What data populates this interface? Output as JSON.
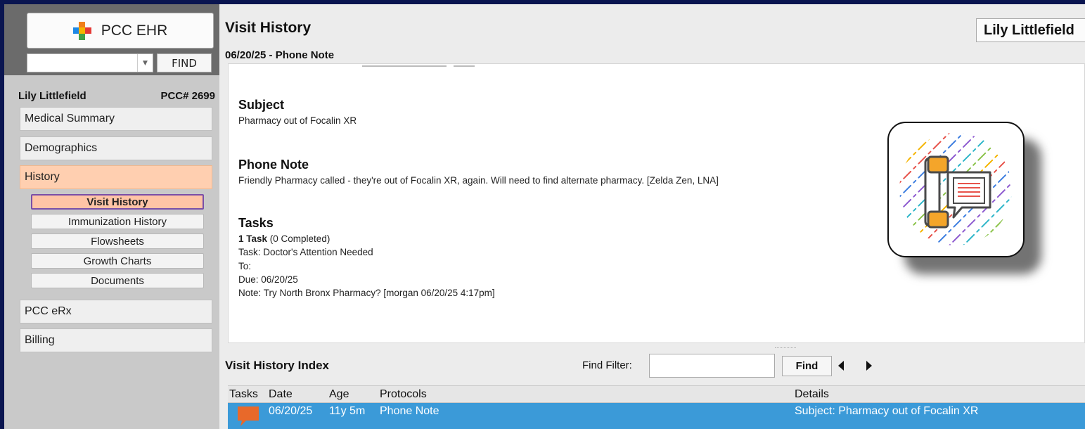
{
  "app": {
    "brand_title": "PCC EHR",
    "find_label": "FIND",
    "search_value": ""
  },
  "patient": {
    "name": "Lily Littlefield",
    "pcc_number": "PCC# 2699"
  },
  "nav": {
    "items": [
      {
        "label": "Medical Summary",
        "active": false
      },
      {
        "label": "Demographics",
        "active": false
      },
      {
        "label": "History",
        "active": true
      },
      {
        "label": "PCC eRx",
        "active": false
      },
      {
        "label": "Billing",
        "active": false
      }
    ],
    "history_sub": [
      {
        "label": "Visit History",
        "active": true
      },
      {
        "label": "Immunization History",
        "active": false
      },
      {
        "label": "Flowsheets",
        "active": false
      },
      {
        "label": "Growth Charts",
        "active": false
      },
      {
        "label": "Documents",
        "active": false
      }
    ]
  },
  "main": {
    "title": "Visit History",
    "patient_button": "Lily Littlefield",
    "note_header": "06/20/25 - Phone Note"
  },
  "note": {
    "subject_title": "Subject",
    "subject_text": "Pharmacy out of Focalin XR",
    "phone_note_title": "Phone Note",
    "phone_note_text": "Friendly Pharmacy called - they're out of Focalin XR, again. Will need to find alternate pharmacy. [Zelda Zen, LNA]",
    "tasks_title": "Tasks",
    "tasks_count_bold": "1 Task",
    "tasks_count_rest": " (0 Completed)",
    "task_name": "Task: Doctor's Attention Needed",
    "task_to": "To:",
    "task_due": "Due:  06/20/25",
    "task_note": "Note: Try North Bronx Pharmacy? [morgan 06/20/25 4:17pm]"
  },
  "index": {
    "title": "Visit History Index",
    "filter_label": "Find Filter:",
    "filter_value": "",
    "find_button": "Find",
    "columns": {
      "tasks": "Tasks",
      "date": "Date",
      "age": "Age",
      "protocols": "Protocols",
      "details": "Details"
    },
    "rows": [
      {
        "date": "06/20/25",
        "age": "11y 5m",
        "protocol": "Phone Note",
        "details": "Subject: Pharmacy out of Focalin XR",
        "selected": true
      }
    ]
  },
  "colors": {
    "frame": "#0a1550",
    "active_nav": "#ffcfb0",
    "selected_row": "#3b9ad8",
    "task_flag": "#e8692a"
  },
  "icons": [
    "brand-logo-icon",
    "chevron-down-icon",
    "phone-note-icon",
    "task-flag-icon",
    "arrow-left-icon",
    "arrow-right-icon"
  ]
}
